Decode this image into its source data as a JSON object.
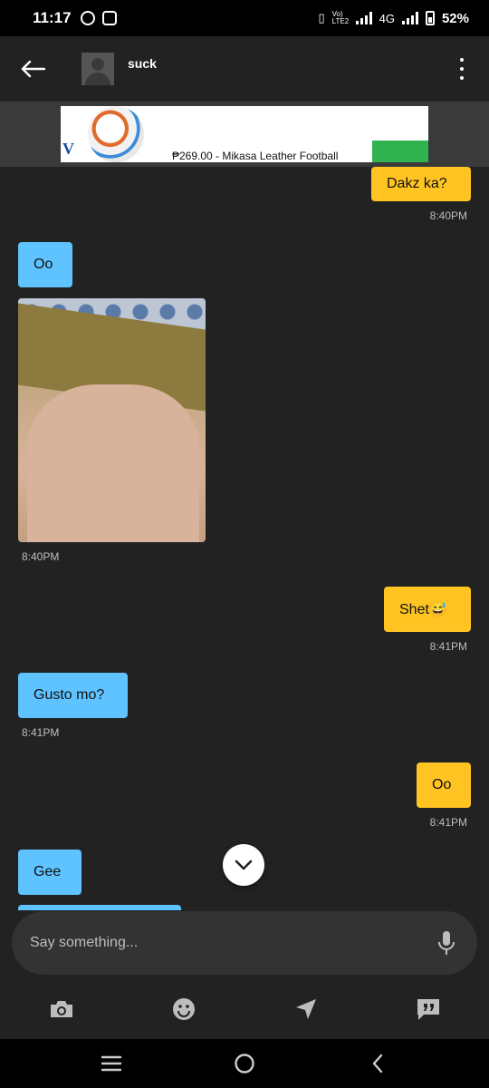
{
  "status_bar": {
    "time": "11:17",
    "network": "4G",
    "volte": "Vo) LTE2",
    "battery": "52%"
  },
  "header": {
    "contact_name": "suck",
    "back_icon": "arrow-left-icon",
    "menu_icon": "more-vertical-icon"
  },
  "ad": {
    "text": "₱269.00 - Mikasa Leather Football",
    "logo": "V"
  },
  "messages": [
    {
      "side": "out",
      "text": "Dakz ka?",
      "time": "8:40PM"
    },
    {
      "side": "in",
      "text": "Oo",
      "time": ""
    },
    {
      "side": "in",
      "type": "photo",
      "time": "8:40PM"
    },
    {
      "side": "out",
      "text": "Shet😅",
      "time": "8:41PM"
    },
    {
      "side": "in",
      "text": "Gusto mo?",
      "time": "8:41PM"
    },
    {
      "side": "out",
      "text": "Oo",
      "time": "8:41PM"
    },
    {
      "side": "in",
      "text": "Gee",
      "time": ""
    }
  ],
  "composer": {
    "placeholder": "Say something...",
    "mic_icon": "microphone-icon"
  },
  "toolbar": {
    "items": [
      "camera-icon",
      "emoji-icon",
      "location-send-icon",
      "quick-reply-icon"
    ]
  },
  "colors": {
    "background": "#222222",
    "outgoing_bubble": "#ffc422",
    "incoming_bubble": "#5ec3ff",
    "timestamp": "#bdbdbd"
  }
}
